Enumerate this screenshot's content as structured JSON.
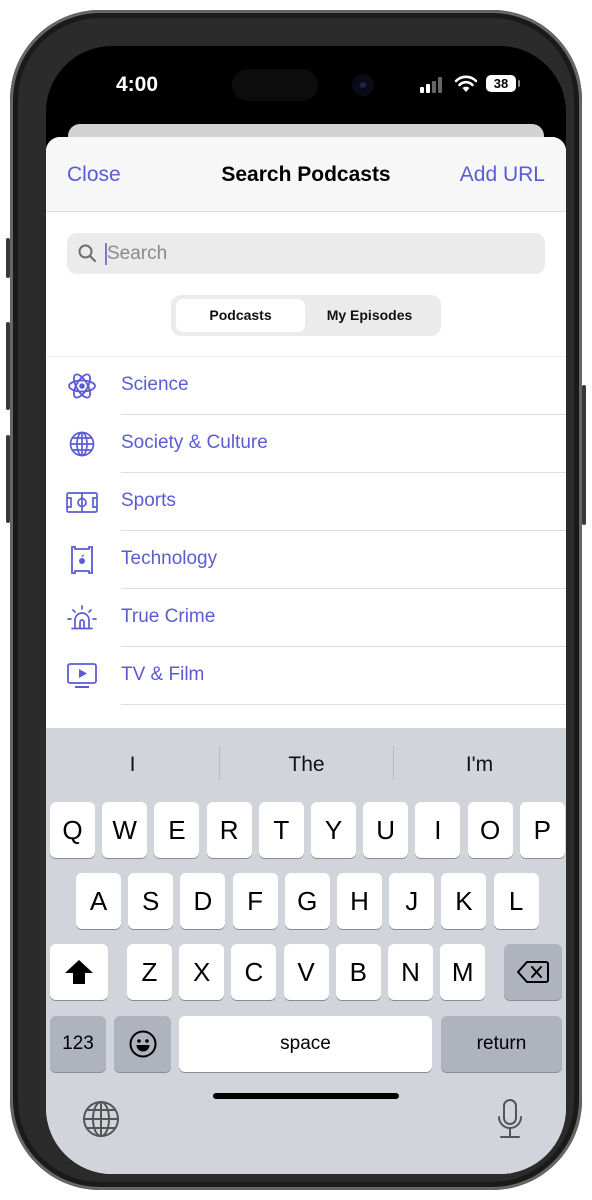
{
  "status_bar": {
    "time": "4:00",
    "battery": "38"
  },
  "navbar": {
    "close_label": "Close",
    "title": "Search Podcasts",
    "add_url_label": "Add URL"
  },
  "search": {
    "placeholder": "Search",
    "value": ""
  },
  "segmented": {
    "items": [
      {
        "label": "Podcasts",
        "selected": true
      },
      {
        "label": "My Episodes",
        "selected": false
      }
    ]
  },
  "accent_color": "#5b5bd6",
  "categories": [
    {
      "label": "Science",
      "icon": "atom-icon"
    },
    {
      "label": "Society & Culture",
      "icon": "globe-icon"
    },
    {
      "label": "Sports",
      "icon": "sports-field-icon"
    },
    {
      "label": "Technology",
      "icon": "computer-chip-icon"
    },
    {
      "label": "True Crime",
      "icon": "siren-icon"
    },
    {
      "label": "TV & Film",
      "icon": "tv-play-icon"
    }
  ],
  "keyboard": {
    "suggestions": [
      "I",
      "The",
      "I'm"
    ],
    "row1": [
      "Q",
      "W",
      "E",
      "R",
      "T",
      "Y",
      "U",
      "I",
      "O",
      "P"
    ],
    "row2": [
      "A",
      "S",
      "D",
      "F",
      "G",
      "H",
      "J",
      "K",
      "L"
    ],
    "row3": [
      "Z",
      "X",
      "C",
      "V",
      "B",
      "N",
      "M"
    ],
    "numbers_label": "123",
    "space_label": "space",
    "return_label": "return"
  }
}
